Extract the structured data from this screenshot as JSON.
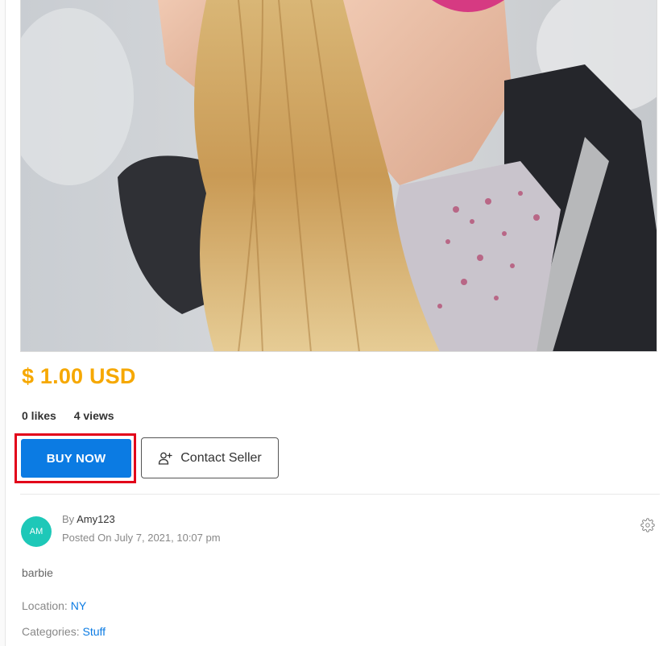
{
  "product": {
    "image_alt": "Barbie doll photo",
    "price": "$ 1.00 USD",
    "likes": "0 likes",
    "views": "4 views"
  },
  "actions": {
    "buy_label": "BUY NOW",
    "contact_label": "Contact Seller"
  },
  "seller": {
    "avatar_initials": "AM",
    "by_prefix": "By",
    "username": "Amy123",
    "posted": "Posted On July 7, 2021, 10:07 pm"
  },
  "listing": {
    "description": "barbie",
    "location_label": "Location:",
    "location_value": "NY",
    "categories_label": "Categories:",
    "categories_value": "Stuff"
  },
  "colors": {
    "price": "#f6a800",
    "buy_button": "#0b7be3",
    "highlight": "#e2001a",
    "avatar": "#1ec8b8",
    "link": "#0b7be3"
  },
  "icons": {
    "contact": "add-user-icon",
    "settings": "gear-icon"
  }
}
